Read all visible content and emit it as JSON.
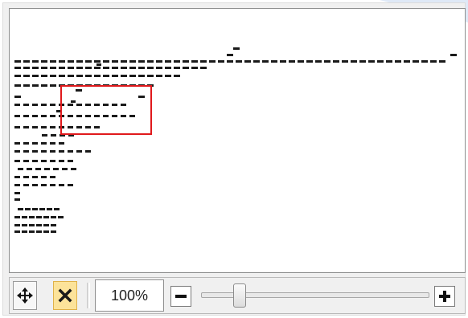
{
  "toolbar": {
    "zoom_level": "100%",
    "zoom_slider_value": 0.15,
    "buttons": {
      "pan": "move-arrows-icon",
      "clear": "close-x-icon",
      "zoom_out": "minus-icon",
      "zoom_in": "plus-icon"
    }
  },
  "colors": {
    "selection_rect": "#e0191c",
    "clear_button_bg": "#fce39a",
    "panel_bg": "#f0f0f0"
  }
}
